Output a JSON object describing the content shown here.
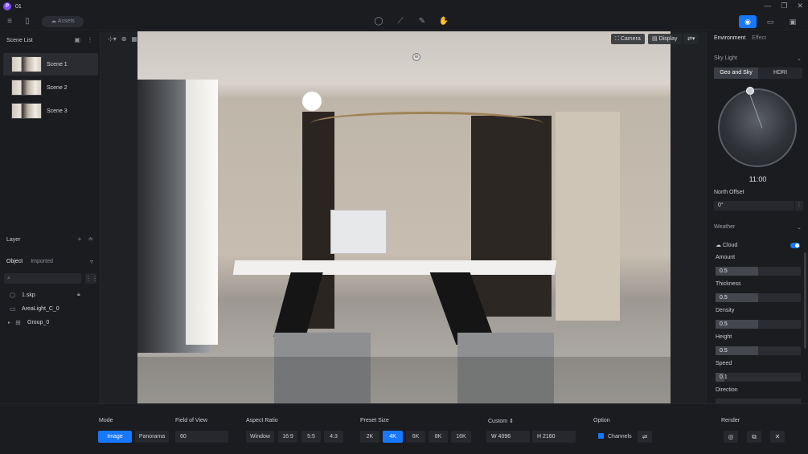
{
  "window": {
    "title": "01",
    "minimize": "—",
    "maximize": "❐",
    "close": "✕",
    "logo": "P"
  },
  "toolbar": {
    "assets_label": "Assets",
    "icons": [
      "menu-icon",
      "file-icon",
      "pin-icon",
      "measure-icon",
      "draw-icon",
      "hand-icon"
    ],
    "right_icons": [
      "camera-icon",
      "video-icon",
      "inbox-icon"
    ]
  },
  "left": {
    "scene_list_title": "Scene List",
    "scenes": [
      {
        "label": "Scene 1"
      },
      {
        "label": "Scene 2"
      },
      {
        "label": "Scene 3"
      }
    ],
    "layer_title": "Layer",
    "tabs": {
      "object": "Object",
      "imported": "Imported"
    },
    "layers": [
      {
        "label": "1.skp"
      },
      {
        "label": "AreaLight_C_0"
      },
      {
        "label": "Group_0"
      }
    ]
  },
  "viewport": {
    "camera_label": "Camera",
    "display_label": "Display"
  },
  "right": {
    "tabs": {
      "environment": "Environment",
      "effect": "Effect"
    },
    "sky_light": "Sky Light",
    "seg_geo": "Geo and Sky",
    "seg_hdri": "HDRI",
    "time": "11:00",
    "north_offset_label": "North Offset",
    "north_offset_value": "0°",
    "weather": "Weather",
    "cloud": "Cloud",
    "sliders": [
      {
        "label": "Amount",
        "value": "0.5",
        "fraction": 0.5
      },
      {
        "label": "Thickness",
        "value": "0.5",
        "fraction": 0.5
      },
      {
        "label": "Density",
        "value": "0.5",
        "fraction": 0.5
      },
      {
        "label": "Height",
        "value": "0.5",
        "fraction": 0.5
      },
      {
        "label": "Speed",
        "value": "0.1",
        "fraction": 0.1
      }
    ],
    "direction_label": "Direction"
  },
  "bottom": {
    "mode_label": "Mode",
    "mode_image": "Image",
    "mode_panorama": "Panorama",
    "fov_label": "Field of View",
    "fov_value": "60",
    "aspect_label": "Aspect Ratio",
    "aspects": [
      "Window",
      "16:9",
      "5:5",
      "4:3"
    ],
    "preset_label": "Preset Size",
    "presets": [
      "2K",
      "4K",
      "6K",
      "8K",
      "16K"
    ],
    "custom_label": "Custom",
    "width": "W  4096",
    "height": "H  2160",
    "option_label": "Option",
    "channels": "Channels",
    "render_label": "Render"
  },
  "colors": {
    "accent": "#1677ff",
    "panel": "#1b1c20",
    "logo": "#7b4dff"
  }
}
